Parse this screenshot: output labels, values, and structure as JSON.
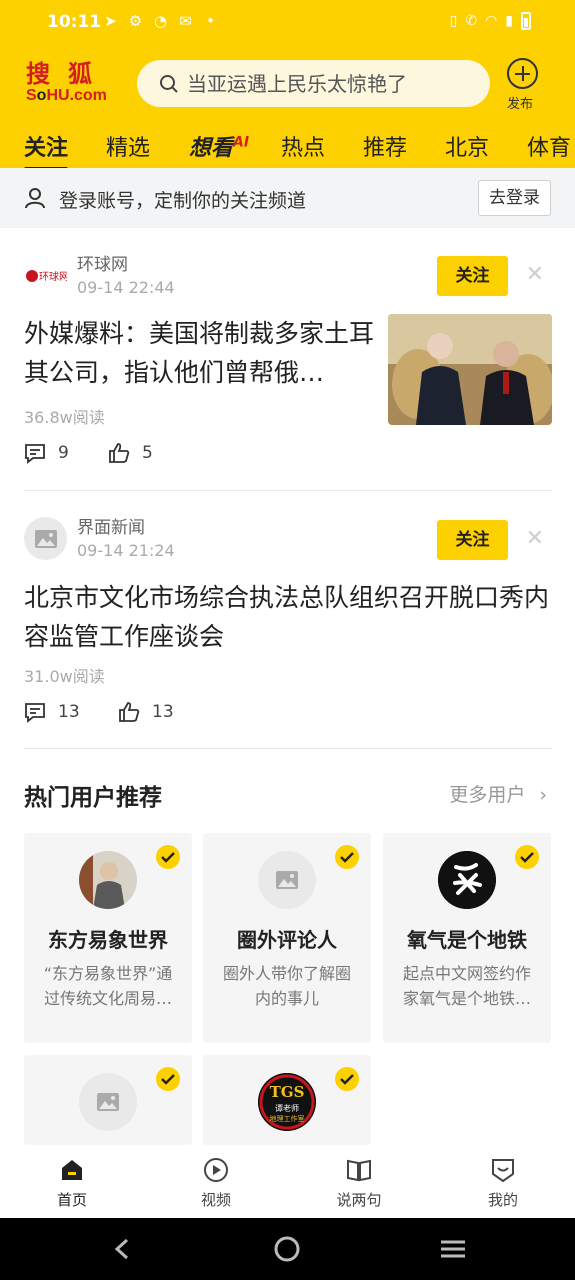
{
  "status_bar": {
    "time": "10:11"
  },
  "header": {
    "logo_cn": "搜狐",
    "logo_en_1": "S",
    "logo_en_2": "HU.com",
    "search_placeholder": "当亚运遇上民乐太惊艳了",
    "publish_label": "发布"
  },
  "tabs": [
    "关注",
    "精选",
    "想看",
    "热点",
    "推荐",
    "北京",
    "体育"
  ],
  "tab_ai_suffix": "AI",
  "login_banner": {
    "text": "登录账号，定制你的关注频道",
    "button": "去登录"
  },
  "feed": [
    {
      "source": "环球网",
      "source_logo_text": "环球网",
      "time": "09-14 22:44",
      "follow": "关注",
      "title": "外媒爆料：美国将制裁多家土耳其公司，指认他们曾帮俄…",
      "reads": "36.8w阅读",
      "comments": "9",
      "likes": "5",
      "has_image": true
    },
    {
      "source": "界面新闻",
      "time": "09-14 21:24",
      "follow": "关注",
      "title": "北京市文化市场综合执法总队组织召开脱口秀内容监管工作座谈会",
      "reads": "31.0w阅读",
      "comments": "13",
      "likes": "13",
      "has_image": false
    }
  ],
  "hot_users": {
    "title": "热门用户推荐",
    "more": "更多用户",
    "cards": [
      {
        "name": "东方易象世界",
        "desc": "“东方易象世界”通过传统文化周易…"
      },
      {
        "name": "圈外评论人",
        "desc": "圈外人带你了解圈内的事儿"
      },
      {
        "name": "氧气是个地铁",
        "desc": "起点中文网签约作家氧气是个地铁…"
      },
      {
        "name": "",
        "desc": ""
      },
      {
        "name": "",
        "desc": "",
        "avatar_text_1": "TGS",
        "avatar_text_2": "谭老师",
        "avatar_text_3": "地理工作室"
      }
    ]
  },
  "bottom_nav": [
    "首页",
    "视频",
    "说两句",
    "我的"
  ],
  "colors": {
    "brand_yellow": "#fdd000",
    "sohu_red": "#d31f1f"
  }
}
